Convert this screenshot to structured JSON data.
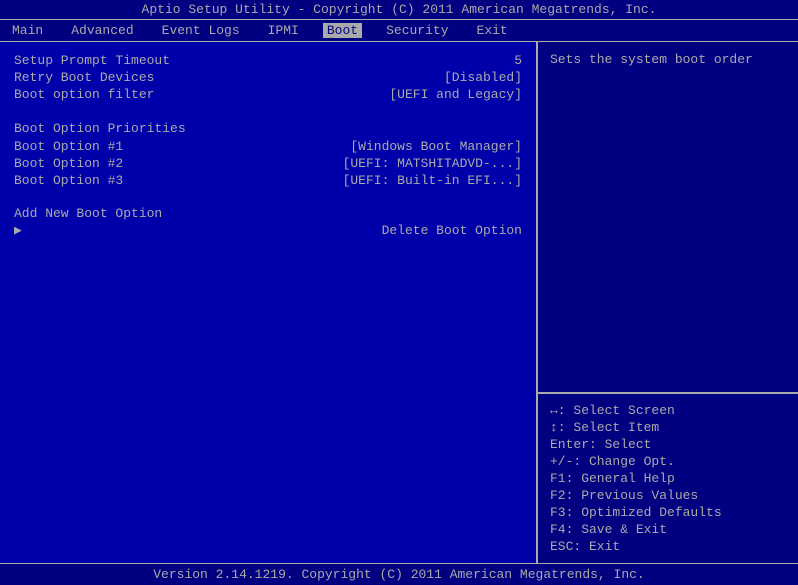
{
  "topBar": {
    "text": "Aptio Setup Utility - Copyright (C) 2011 American Megatrends, Inc."
  },
  "nav": {
    "items": [
      {
        "label": "Main",
        "active": false
      },
      {
        "label": "Advanced",
        "active": false
      },
      {
        "label": "Event Logs",
        "active": false
      },
      {
        "label": "IPMI",
        "active": false
      },
      {
        "label": "Boot",
        "active": true
      },
      {
        "label": "Security",
        "active": false
      },
      {
        "label": "Exit",
        "active": false
      }
    ]
  },
  "left": {
    "items": [
      {
        "label": "Setup Prompt Timeout",
        "value": "5",
        "type": "item"
      },
      {
        "label": "Retry Boot Devices",
        "value": "[Disabled]",
        "type": "item"
      },
      {
        "label": "Boot option filter",
        "value": "[UEFI and Legacy]",
        "type": "item"
      },
      {
        "label": "",
        "value": "",
        "type": "spacer"
      },
      {
        "label": "Boot Option Priorities",
        "value": "",
        "type": "header"
      },
      {
        "label": "Boot Option #1",
        "value": "[Windows Boot Manager]",
        "type": "item"
      },
      {
        "label": "Boot Option #2",
        "value": "[UEFI: MATSHITADVD-...]",
        "type": "item"
      },
      {
        "label": "Boot Option #3",
        "value": "[UEFI: Built-in EFI...]",
        "type": "item"
      },
      {
        "label": "",
        "value": "",
        "type": "spacer"
      },
      {
        "label": "",
        "value": "",
        "type": "spacer"
      },
      {
        "label": "Add New Boot Option",
        "value": "",
        "type": "item"
      },
      {
        "label": "Delete Boot Option",
        "value": "",
        "type": "arrow"
      }
    ]
  },
  "helpText": "Sets the system boot order",
  "keyGuide": {
    "lines": [
      "↔: Select Screen",
      "↕: Select Item",
      "Enter: Select",
      "+/-: Change Opt.",
      "F1: General Help",
      "F2: Previous Values",
      "F3: Optimized Defaults",
      "F4: Save & Exit",
      "ESC: Exit"
    ]
  },
  "bottomBar": {
    "text": "Version 2.14.1219. Copyright (C) 2011 American Megatrends, Inc."
  }
}
